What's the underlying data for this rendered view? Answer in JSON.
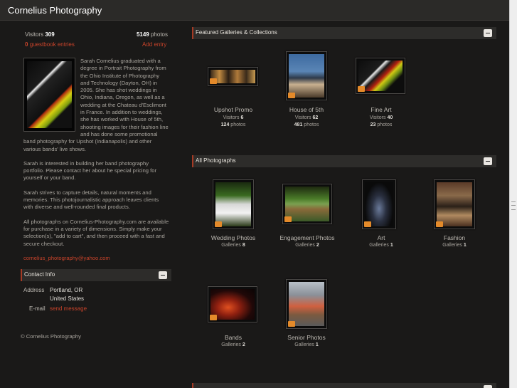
{
  "site": {
    "title": "Cornelius Photography"
  },
  "stats": {
    "visitors_label": "Visitors",
    "visitors": "309",
    "photos_count": "5149",
    "photos_label": "photos",
    "guestbook_count": "0",
    "guestbook_label": "guestbook entries",
    "add_entry": "Add entry"
  },
  "bio": {
    "p1": "Sarah Cornelius graduated with a degree in Portrait Photography from the Ohio Institute of Photography and Technology (Dayton, OH) in 2005. She has shot weddings in Ohio, Indiana, Oregon, as well as a wedding at the Chateau d'Esclimont in France. In addition to weddings, she has worked with House of 5th, shooting images for their fashion line and has done some promotional band photography for Upshot (Indianapolis) and other various bands' live shows.",
    "p2": "Sarah is interested in building her band photography portfolio. Please contact her about he special pricing for yourself or your band.",
    "p3": "Sarah strives to capture details, natural moments and memories. This photojournalistic approach leaves clients with diverse and well-rounded final products.",
    "p4": "All photographs on Cornelius-Photography.com are available for purchase in a variety of dimensions. Simply make your selection(s), \"add to cart\", and then proceed with a fast and secure checkout.",
    "email": "cornelius_photography@yahoo.com"
  },
  "contact": {
    "header": "Contact Info",
    "address_label": "Address",
    "address_line1": "Portland, OR",
    "address_line2": "United States",
    "email_label": "E-mail",
    "email_link": "send message"
  },
  "featured": {
    "header": "Featured Galleries & Collections",
    "items": [
      {
        "title": "Upshot Promo",
        "visitors_label": "Visitors",
        "visitors": "6",
        "photos": "124",
        "photos_label": "photos"
      },
      {
        "title": "House of 5th",
        "visitors_label": "Visitors",
        "visitors": "62",
        "photos": "481",
        "photos_label": "photos"
      },
      {
        "title": "Fine Art",
        "visitors_label": "Visitors",
        "visitors": "40",
        "photos": "23",
        "photos_label": "photos"
      }
    ]
  },
  "all_photos": {
    "header": "All Photographs",
    "items": [
      {
        "title": "Wedding Photos",
        "label": "Galleries",
        "count": "8"
      },
      {
        "title": "Engagement Photos",
        "label": "Galleries",
        "count": "2"
      },
      {
        "title": "Art",
        "label": "Galleries",
        "count": "1"
      },
      {
        "title": "Fashion",
        "label": "Galleries",
        "count": "1"
      },
      {
        "title": "Bands",
        "label": "Galleries",
        "count": "2"
      },
      {
        "title": "Senior Photos",
        "label": "Galleries",
        "count": "1"
      }
    ]
  },
  "footer": {
    "copyright": "© Cornelius Photography"
  }
}
